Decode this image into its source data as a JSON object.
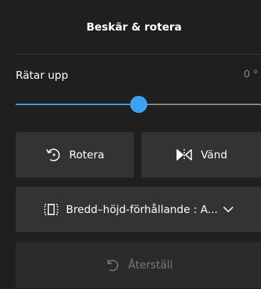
{
  "panel": {
    "title": "Beskär & rotera",
    "straighten": {
      "label": "Rätar upp",
      "value_text": "0 °",
      "level": 0.5
    },
    "rotate_label": "Rotera",
    "flip_label": "Vänd",
    "aspect_label": "Bredd–höjd-förhållande : A...",
    "reset_label": "Återställ"
  },
  "colors": {
    "accent": "#3ea1f2",
    "background": "#1f1f1f",
    "button": "#333333",
    "button_disabled": "#2b2b2b",
    "disabled_text": "#7a7a7a"
  },
  "icons": {
    "rotate": "rotate-icon",
    "flip": "flip-icon",
    "aspect": "aspect-ratio-icon",
    "chevron": "chevron-down-icon",
    "reset": "undo-icon"
  }
}
